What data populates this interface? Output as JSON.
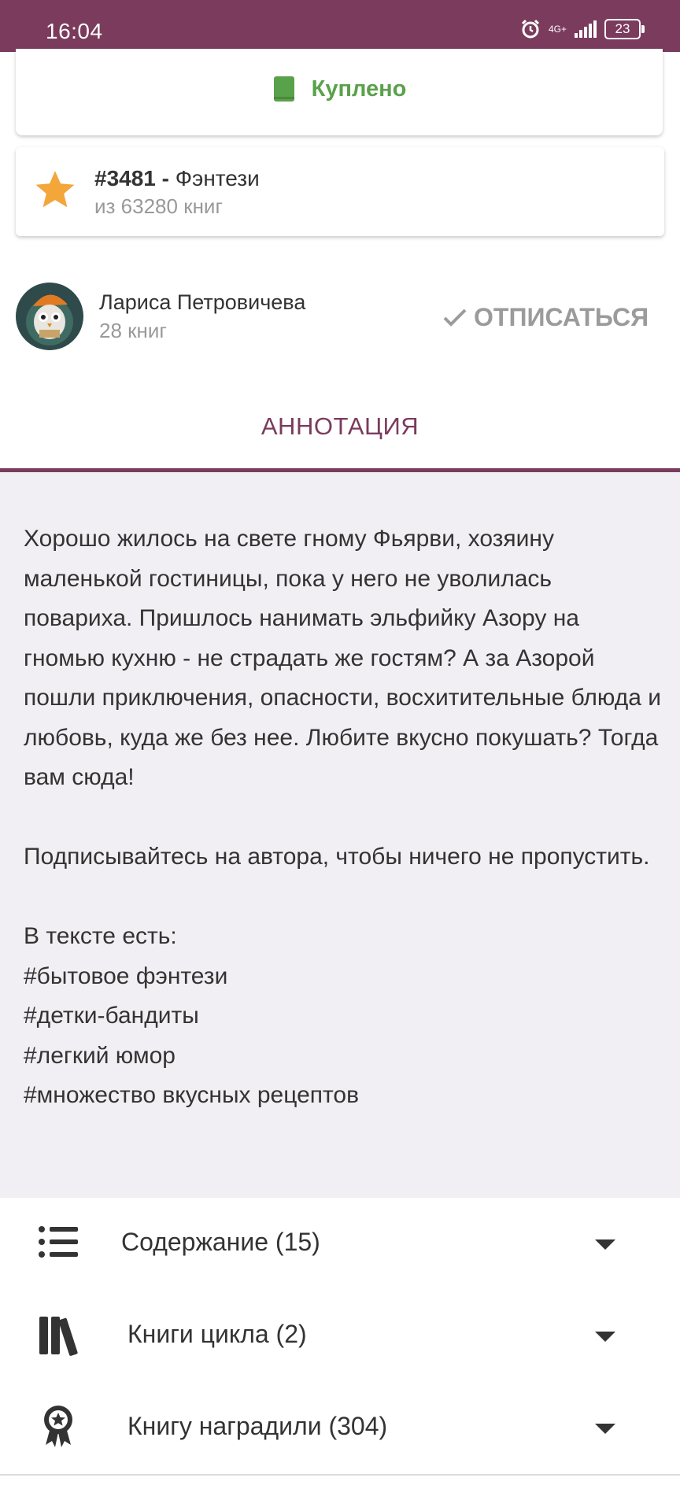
{
  "status_bar": {
    "time": "16:04",
    "network": "4G+",
    "battery": "23"
  },
  "purchase": {
    "label": "Куплено",
    "color": "#5aa14b"
  },
  "rank": {
    "number": "#3481 -",
    "genre": "Фэнтези",
    "total": "из 63280 книг"
  },
  "author": {
    "name": "Лариса Петровичева",
    "books": "28 книг",
    "unsubscribe_label": "ОТПИСАТЬСЯ"
  },
  "tab": {
    "label": "АННОТАЦИЯ",
    "accent": "#7b3b5d"
  },
  "annotation": {
    "paragraphs": [
      "Хорошо жилось на свете гному Фьярви, хозяину маленькой гостиницы, пока у него не уволилась повариха. Пришлось нанимать эльфийку Азору на гномью кухню - не страдать же гостям? А за Азорой пошли приключения, опасности, восхитительные блюда и любовь, куда же без нее. Любите вкусно покушать? Тогда вам сюда!",
      "Подписывайтесь на автора, чтобы ничего не пропустить."
    ],
    "tags_header": "В тексте есть:",
    "tags": [
      "#бытовое фэнтези",
      "#детки-бандиты",
      "#легкий юмор",
      "#множество вкусных рецептов"
    ]
  },
  "sections": [
    {
      "label": "Содержание (15)",
      "icon": "list-icon"
    },
    {
      "label": "Книги цикла (2)",
      "icon": "books-icon"
    },
    {
      "label": "Книгу наградили (304)",
      "icon": "award-icon"
    }
  ]
}
